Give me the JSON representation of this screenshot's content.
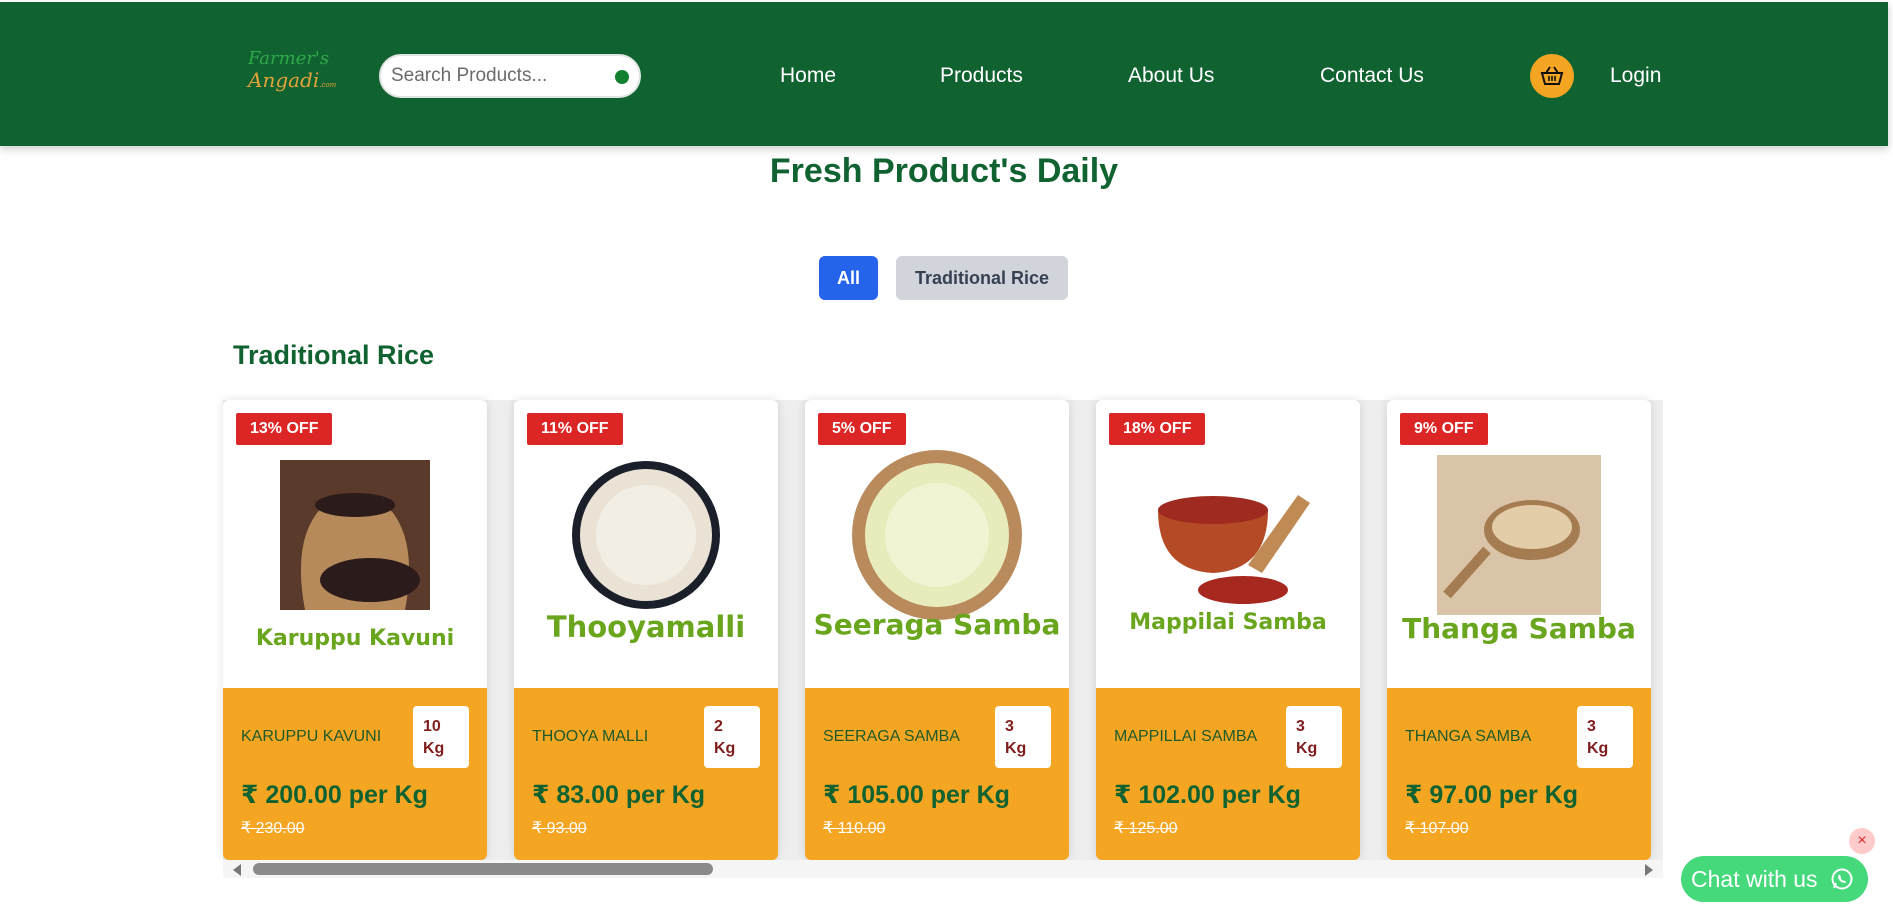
{
  "header": {
    "logo_line1": "Farmer's",
    "logo_line2": "Angadi",
    "logo_suffix": ".com",
    "search_placeholder": "Search Products...",
    "nav": [
      "Home",
      "Products",
      "About Us",
      "Contact Us"
    ],
    "login": "Login"
  },
  "page_title": "Fresh Product's Daily",
  "filters": {
    "all": "All",
    "traditional": "Traditional Rice"
  },
  "section_title": "Traditional Rice",
  "products": [
    {
      "discount": "13% OFF",
      "art_label": "Karuppu Kavuni",
      "name": "KARUPPU KAVUNI",
      "weight_value": "10",
      "weight_unit": "Kg",
      "price": "₹ 200.00 per Kg",
      "old_price": "₹ 230.00"
    },
    {
      "discount": "11% OFF",
      "art_label": "Thooyamalli",
      "name": "THOOYA MALLI",
      "weight_value": "2",
      "weight_unit": "Kg",
      "price": "₹ 83.00 per Kg",
      "old_price": "₹ 93.00"
    },
    {
      "discount": "5% OFF",
      "art_label": "Seeraga Samba",
      "name": "SEERAGA SAMBA",
      "weight_value": "3",
      "weight_unit": "Kg",
      "price": "₹ 105.00 per Kg",
      "old_price": "₹ 110.00"
    },
    {
      "discount": "18% OFF",
      "art_label": "Mappilai Samba",
      "name": "MAPPILLAI SAMBA",
      "weight_value": "3",
      "weight_unit": "Kg",
      "price": "₹ 102.00 per Kg",
      "old_price": "₹ 125.00"
    },
    {
      "discount": "9% OFF",
      "art_label": "Thanga Samba",
      "name": "THANGA SAMBA",
      "weight_value": "3",
      "weight_unit": "Kg",
      "price": "₹ 97.00 per Kg",
      "old_price": "₹ 107.00"
    }
  ],
  "chat": {
    "label": "Chat with us",
    "close": "×"
  },
  "colors": {
    "header": "#116231",
    "accent": "#f4a622",
    "badge": "#dc2626",
    "filter_active": "#2563eb"
  }
}
